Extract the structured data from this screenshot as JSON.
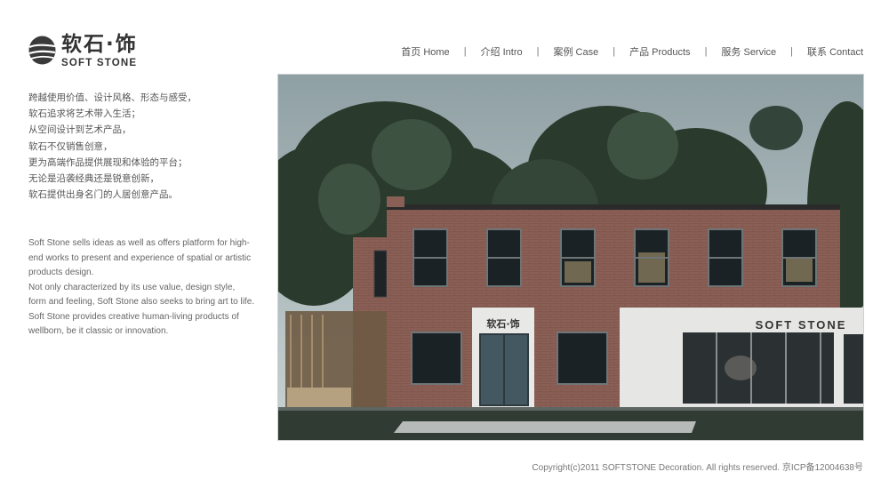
{
  "logo": {
    "cn": "软石·饰",
    "en": "SOFT STONE"
  },
  "nav": {
    "items": [
      {
        "label": "首页 Home"
      },
      {
        "label": "介绍 Intro"
      },
      {
        "label": "案例 Case"
      },
      {
        "label": "产品 Products"
      },
      {
        "label": "服务 Service"
      },
      {
        "label": "联系 Contact"
      }
    ],
    "separator": "|"
  },
  "intro": {
    "cn_lines": [
      "跨越使用价值、设计风格、形态与感受，",
      "软石追求将艺术带入生活；",
      "从空间设计到艺术产品，",
      "软石不仅销售创意，",
      "更为高端作品提供展现和体验的平台；",
      "无论是沿袭经典还是锐意创新，",
      "软石提供出身名门的人居创意产品。"
    ],
    "en_paragraphs": [
      "Soft Stone sells ideas as well as offers platform for high-end works to present and experience of spatial or artistic products design.",
      "Not only characterized by its use value, design style, form and feeling, Soft Stone also seeks to bring art to life.",
      "Soft Stone provides creative human-living products of wellborn, be it classic or innovation."
    ]
  },
  "hero": {
    "door_sign": "软石·饰",
    "facade_sign": "SOFT STONE"
  },
  "footer": {
    "copyright": "Copyright(c)2011 SOFTSTONE Decoration. All rights reserved. 京ICP备12004638号"
  }
}
